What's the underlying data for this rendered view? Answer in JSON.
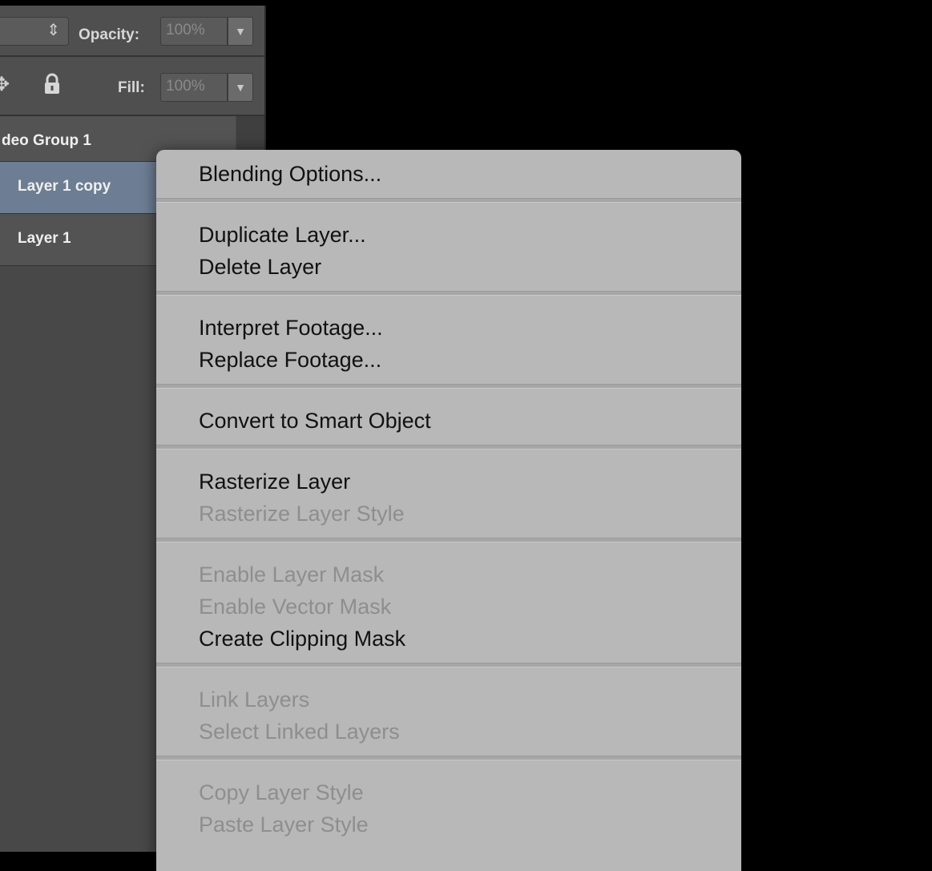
{
  "panel": {
    "opacity_label": "Opacity:",
    "opacity_value": "100%",
    "fill_label": "Fill:",
    "fill_value": "100%",
    "dropdown_glyph": "▼",
    "blend_arrows_glyph": "⇕",
    "layers": [
      {
        "name": "deo Group 1",
        "selected": false
      },
      {
        "name": "Layer 1 copy",
        "selected": true
      },
      {
        "name": "Layer 1",
        "selected": false
      }
    ]
  },
  "menu": {
    "groups": [
      [
        {
          "label": "Blending Options...",
          "enabled": true
        }
      ],
      [
        {
          "label": "Duplicate Layer...",
          "enabled": true
        },
        {
          "label": "Delete Layer",
          "enabled": true
        }
      ],
      [
        {
          "label": "Interpret Footage...",
          "enabled": true
        },
        {
          "label": "Replace Footage...",
          "enabled": true
        }
      ],
      [
        {
          "label": "Convert to Smart Object",
          "enabled": true
        }
      ],
      [
        {
          "label": "Rasterize Layer",
          "enabled": true
        },
        {
          "label": "Rasterize Layer Style",
          "enabled": false
        }
      ],
      [
        {
          "label": "Enable Layer Mask",
          "enabled": false
        },
        {
          "label": "Enable Vector Mask",
          "enabled": false
        },
        {
          "label": "Create Clipping Mask",
          "enabled": true
        }
      ],
      [
        {
          "label": "Link Layers",
          "enabled": false
        },
        {
          "label": "Select Linked Layers",
          "enabled": false
        }
      ],
      [
        {
          "label": "Copy Layer Style",
          "enabled": false
        },
        {
          "label": "Paste Layer Style",
          "enabled": false
        }
      ]
    ]
  }
}
